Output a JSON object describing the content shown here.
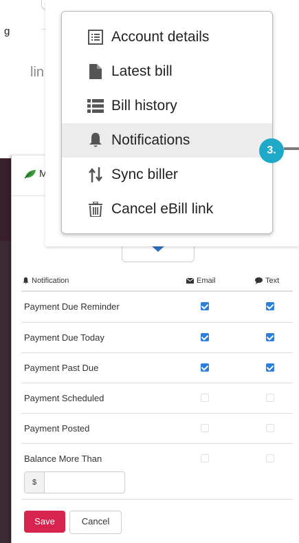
{
  "background": {
    "fragment_left": "g",
    "fragment_mid": "lin"
  },
  "modal": {
    "header_initial": "M"
  },
  "menu": {
    "items": [
      {
        "label": "Account details",
        "icon": "list-alt-icon"
      },
      {
        "label": "Latest bill",
        "icon": "document-icon"
      },
      {
        "label": "Bill history",
        "icon": "list-icon"
      },
      {
        "label": "Notifications",
        "icon": "bell-icon",
        "active": true
      },
      {
        "label": "Sync biller",
        "icon": "sort-arrows-icon"
      },
      {
        "label": "Cancel eBill link",
        "icon": "trash-icon"
      }
    ]
  },
  "step_badge": "3.",
  "table": {
    "col_notification": "Notification",
    "col_email": "Email",
    "col_text": "Text",
    "rows": [
      {
        "label": "Payment Due Reminder",
        "email": true,
        "text": true
      },
      {
        "label": "Payment Due Today",
        "email": true,
        "text": true
      },
      {
        "label": "Payment Past Due",
        "email": true,
        "text": true
      },
      {
        "label": "Payment Scheduled",
        "email": false,
        "text": false
      },
      {
        "label": "Payment Posted",
        "email": false,
        "text": false
      },
      {
        "label": "Balance More Than",
        "email": false,
        "text": false
      }
    ]
  },
  "amount": {
    "prefix": "$",
    "value": ""
  },
  "buttons": {
    "save": "Save",
    "cancel": "Cancel"
  },
  "colors": {
    "accent_save": "#d6244e",
    "checkbox": "#2d7fdc",
    "badge": "#1fa9c9"
  }
}
